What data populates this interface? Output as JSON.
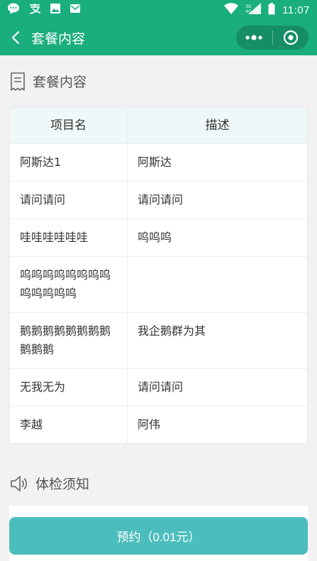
{
  "status_bar": {
    "time": "11:07",
    "left_icons": [
      "message-bubble-icon",
      "alipay-icon",
      "image-icon",
      "mail-icon"
    ],
    "right_icons": [
      "wifi-icon",
      "cell-signal-icon",
      "battery-icon"
    ]
  },
  "nav": {
    "title": "套餐内容"
  },
  "package_section": {
    "title": "套餐内容",
    "columns": [
      "项目名",
      "描述"
    ],
    "rows": [
      {
        "name": "阿斯达1",
        "desc": "阿斯达"
      },
      {
        "name": "请问请问",
        "desc": "请问请问"
      },
      {
        "name": "哇哇哇哇哇哇",
        "desc": "呜呜呜"
      },
      {
        "name": "呜呜呜呜呜呜呜呜呜呜呜呜呜",
        "desc": ""
      },
      {
        "name": "鹅鹅鹅鹅鹅鹅鹅鹅鹅鹅鹅",
        "desc": "我企鹅群为其"
      },
      {
        "name": "无我无为",
        "desc": "请问请问"
      },
      {
        "name": "李越",
        "desc": "阿伟"
      }
    ]
  },
  "notice_section": {
    "title": "体检须知"
  },
  "booking": {
    "label": "预约（0.01元）"
  },
  "colors": {
    "primary": "#1aad7e",
    "button": "#4cbdbd",
    "table_header_bg": "#eef8f8",
    "page_bg": "#f2f2f2"
  }
}
